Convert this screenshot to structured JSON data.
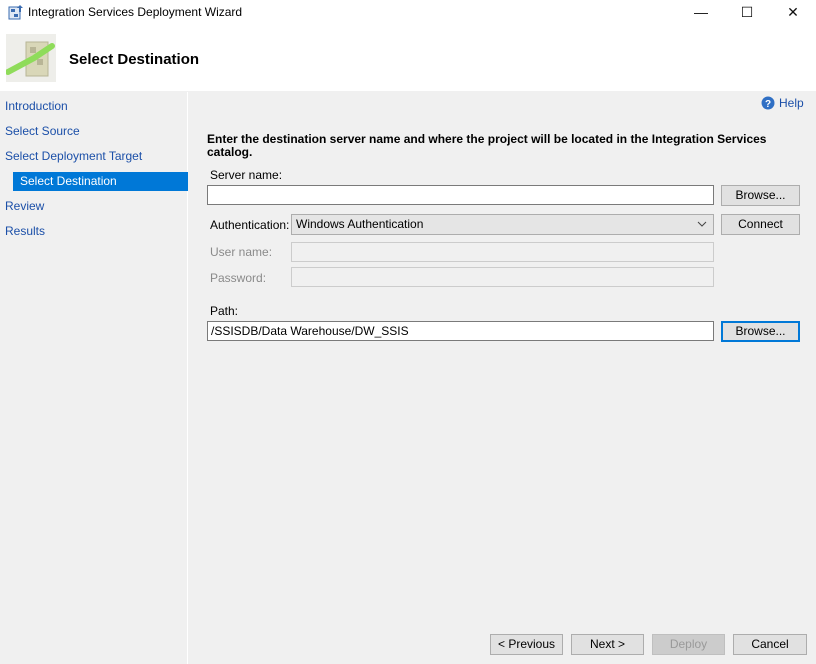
{
  "window": {
    "title": "Integration Services Deployment Wizard",
    "minimize": "—",
    "maximize": "☐",
    "close": "✕"
  },
  "header": {
    "title": "Select Destination"
  },
  "nav": {
    "items": [
      {
        "label": "Introduction",
        "selected": false
      },
      {
        "label": "Select Source",
        "selected": false
      },
      {
        "label": "Select Deployment Target",
        "selected": false
      },
      {
        "label": "Select Destination",
        "selected": true
      },
      {
        "label": "Review",
        "selected": false
      },
      {
        "label": "Results",
        "selected": false
      }
    ]
  },
  "help": {
    "label": "Help",
    "icon": "help-icon"
  },
  "form": {
    "instructions": "Enter the destination server name and where the project will be located in the Integration Services catalog.",
    "server_name_label": "Server name:",
    "server_name_value": "",
    "browse_label": "Browse...",
    "authentication_label": "Authentication:",
    "authentication_value": "Windows Authentication",
    "connect_label": "Connect",
    "user_name_label": "User name:",
    "password_label": "Password:",
    "path_label": "Path:",
    "path_value": "/SSISDB/Data Warehouse/DW_SSIS",
    "path_browse_label": "Browse..."
  },
  "footer": {
    "previous": "< Previous",
    "next": "Next >",
    "deploy": "Deploy",
    "cancel": "Cancel"
  },
  "colors": {
    "accent": "#0078d7",
    "nav_link": "#1b4fa8"
  }
}
